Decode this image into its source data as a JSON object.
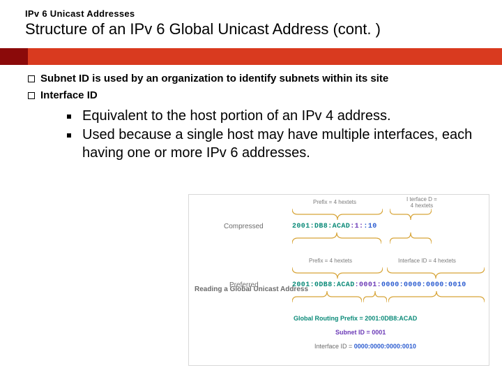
{
  "header": {
    "supertitle": "IPv 6 Unicast Addresses",
    "title": "Structure of an IPv 6 Global Unicast Address (cont. )"
  },
  "bullets": {
    "item1": "Subnet ID is used by an organization to identify subnets within its site",
    "item2": "Interface ID",
    "sub1": "Equivalent to the host portion of an IPv 4 address.",
    "sub2": "Used because a single host may have multiple interfaces, each having one or more IPv 6 addresses."
  },
  "diagram": {
    "label_compressed": "Compressed",
    "label_preferred": "Preferred",
    "reading_caption": "Reading a Global Unicast Address",
    "cap_prefix": "Prefix = 4 hextets",
    "cap_interface_top": "I terface D =\n4 hextets",
    "cap_interface": "Interface ID = 4 hextets",
    "compressed": {
      "prefix": "2001:DB8:ACAD",
      "subnet": ":1:",
      "iid": ":10"
    },
    "preferred": {
      "prefix": "2001:0DB8:ACAD",
      "subnet": ":0001:",
      "iid": "0000:0000:0000:0010"
    },
    "eq_grp_label": "Global Routing Prefix  =",
    "eq_grp_val": "2001:0DB8:ACAD",
    "eq_sub_label": "Subnet ID  =",
    "eq_sub_val": "0001",
    "eq_iid_label": "Interface ID  =",
    "eq_iid_val": "0000:0000:0000:0010"
  }
}
